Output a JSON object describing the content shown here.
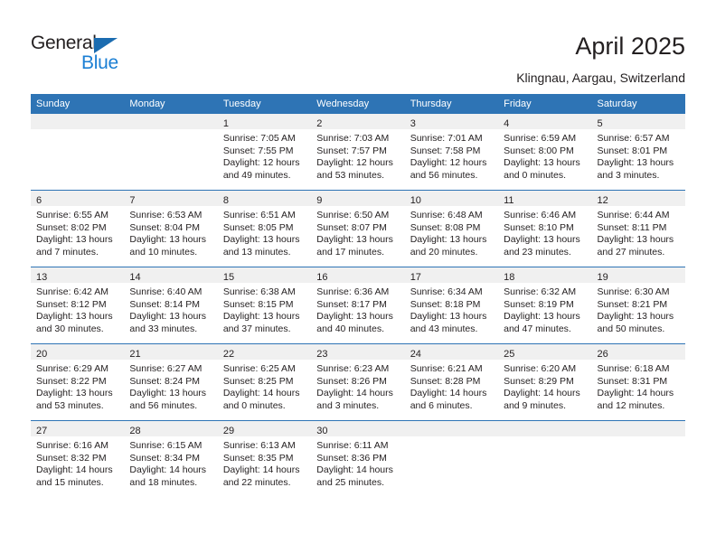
{
  "logo": {
    "word_top": "General",
    "word_bottom": "Blue",
    "triangle_color": "#1b6cb0",
    "bottom_color": "#1b7fd4"
  },
  "header": {
    "title": "April 2025",
    "subtitle": "Klingnau, Aargau, Switzerland",
    "accent_color": "#2e74b5",
    "daystrip_color": "#f0f0f0"
  },
  "weekdays": [
    "Sunday",
    "Monday",
    "Tuesday",
    "Wednesday",
    "Thursday",
    "Friday",
    "Saturday"
  ],
  "weeks": [
    [
      {
        "day": "",
        "empty": true
      },
      {
        "day": "",
        "empty": true
      },
      {
        "day": "1",
        "sunrise": "Sunrise: 7:05 AM",
        "sunset": "Sunset: 7:55 PM",
        "daylight1": "Daylight: 12 hours",
        "daylight2": "and 49 minutes."
      },
      {
        "day": "2",
        "sunrise": "Sunrise: 7:03 AM",
        "sunset": "Sunset: 7:57 PM",
        "daylight1": "Daylight: 12 hours",
        "daylight2": "and 53 minutes."
      },
      {
        "day": "3",
        "sunrise": "Sunrise: 7:01 AM",
        "sunset": "Sunset: 7:58 PM",
        "daylight1": "Daylight: 12 hours",
        "daylight2": "and 56 minutes."
      },
      {
        "day": "4",
        "sunrise": "Sunrise: 6:59 AM",
        "sunset": "Sunset: 8:00 PM",
        "daylight1": "Daylight: 13 hours",
        "daylight2": "and 0 minutes."
      },
      {
        "day": "5",
        "sunrise": "Sunrise: 6:57 AM",
        "sunset": "Sunset: 8:01 PM",
        "daylight1": "Daylight: 13 hours",
        "daylight2": "and 3 minutes."
      }
    ],
    [
      {
        "day": "6",
        "sunrise": "Sunrise: 6:55 AM",
        "sunset": "Sunset: 8:02 PM",
        "daylight1": "Daylight: 13 hours",
        "daylight2": "and 7 minutes."
      },
      {
        "day": "7",
        "sunrise": "Sunrise: 6:53 AM",
        "sunset": "Sunset: 8:04 PM",
        "daylight1": "Daylight: 13 hours",
        "daylight2": "and 10 minutes."
      },
      {
        "day": "8",
        "sunrise": "Sunrise: 6:51 AM",
        "sunset": "Sunset: 8:05 PM",
        "daylight1": "Daylight: 13 hours",
        "daylight2": "and 13 minutes."
      },
      {
        "day": "9",
        "sunrise": "Sunrise: 6:50 AM",
        "sunset": "Sunset: 8:07 PM",
        "daylight1": "Daylight: 13 hours",
        "daylight2": "and 17 minutes."
      },
      {
        "day": "10",
        "sunrise": "Sunrise: 6:48 AM",
        "sunset": "Sunset: 8:08 PM",
        "daylight1": "Daylight: 13 hours",
        "daylight2": "and 20 minutes."
      },
      {
        "day": "11",
        "sunrise": "Sunrise: 6:46 AM",
        "sunset": "Sunset: 8:10 PM",
        "daylight1": "Daylight: 13 hours",
        "daylight2": "and 23 minutes."
      },
      {
        "day": "12",
        "sunrise": "Sunrise: 6:44 AM",
        "sunset": "Sunset: 8:11 PM",
        "daylight1": "Daylight: 13 hours",
        "daylight2": "and 27 minutes."
      }
    ],
    [
      {
        "day": "13",
        "sunrise": "Sunrise: 6:42 AM",
        "sunset": "Sunset: 8:12 PM",
        "daylight1": "Daylight: 13 hours",
        "daylight2": "and 30 minutes."
      },
      {
        "day": "14",
        "sunrise": "Sunrise: 6:40 AM",
        "sunset": "Sunset: 8:14 PM",
        "daylight1": "Daylight: 13 hours",
        "daylight2": "and 33 minutes."
      },
      {
        "day": "15",
        "sunrise": "Sunrise: 6:38 AM",
        "sunset": "Sunset: 8:15 PM",
        "daylight1": "Daylight: 13 hours",
        "daylight2": "and 37 minutes."
      },
      {
        "day": "16",
        "sunrise": "Sunrise: 6:36 AM",
        "sunset": "Sunset: 8:17 PM",
        "daylight1": "Daylight: 13 hours",
        "daylight2": "and 40 minutes."
      },
      {
        "day": "17",
        "sunrise": "Sunrise: 6:34 AM",
        "sunset": "Sunset: 8:18 PM",
        "daylight1": "Daylight: 13 hours",
        "daylight2": "and 43 minutes."
      },
      {
        "day": "18",
        "sunrise": "Sunrise: 6:32 AM",
        "sunset": "Sunset: 8:19 PM",
        "daylight1": "Daylight: 13 hours",
        "daylight2": "and 47 minutes."
      },
      {
        "day": "19",
        "sunrise": "Sunrise: 6:30 AM",
        "sunset": "Sunset: 8:21 PM",
        "daylight1": "Daylight: 13 hours",
        "daylight2": "and 50 minutes."
      }
    ],
    [
      {
        "day": "20",
        "sunrise": "Sunrise: 6:29 AM",
        "sunset": "Sunset: 8:22 PM",
        "daylight1": "Daylight: 13 hours",
        "daylight2": "and 53 minutes."
      },
      {
        "day": "21",
        "sunrise": "Sunrise: 6:27 AM",
        "sunset": "Sunset: 8:24 PM",
        "daylight1": "Daylight: 13 hours",
        "daylight2": "and 56 minutes."
      },
      {
        "day": "22",
        "sunrise": "Sunrise: 6:25 AM",
        "sunset": "Sunset: 8:25 PM",
        "daylight1": "Daylight: 14 hours",
        "daylight2": "and 0 minutes."
      },
      {
        "day": "23",
        "sunrise": "Sunrise: 6:23 AM",
        "sunset": "Sunset: 8:26 PM",
        "daylight1": "Daylight: 14 hours",
        "daylight2": "and 3 minutes."
      },
      {
        "day": "24",
        "sunrise": "Sunrise: 6:21 AM",
        "sunset": "Sunset: 8:28 PM",
        "daylight1": "Daylight: 14 hours",
        "daylight2": "and 6 minutes."
      },
      {
        "day": "25",
        "sunrise": "Sunrise: 6:20 AM",
        "sunset": "Sunset: 8:29 PM",
        "daylight1": "Daylight: 14 hours",
        "daylight2": "and 9 minutes."
      },
      {
        "day": "26",
        "sunrise": "Sunrise: 6:18 AM",
        "sunset": "Sunset: 8:31 PM",
        "daylight1": "Daylight: 14 hours",
        "daylight2": "and 12 minutes."
      }
    ],
    [
      {
        "day": "27",
        "sunrise": "Sunrise: 6:16 AM",
        "sunset": "Sunset: 8:32 PM",
        "daylight1": "Daylight: 14 hours",
        "daylight2": "and 15 minutes."
      },
      {
        "day": "28",
        "sunrise": "Sunrise: 6:15 AM",
        "sunset": "Sunset: 8:34 PM",
        "daylight1": "Daylight: 14 hours",
        "daylight2": "and 18 minutes."
      },
      {
        "day": "29",
        "sunrise": "Sunrise: 6:13 AM",
        "sunset": "Sunset: 8:35 PM",
        "daylight1": "Daylight: 14 hours",
        "daylight2": "and 22 minutes."
      },
      {
        "day": "30",
        "sunrise": "Sunrise: 6:11 AM",
        "sunset": "Sunset: 8:36 PM",
        "daylight1": "Daylight: 14 hours",
        "daylight2": "and 25 minutes."
      },
      {
        "day": "",
        "empty": true
      },
      {
        "day": "",
        "empty": true
      },
      {
        "day": "",
        "empty": true
      }
    ]
  ]
}
